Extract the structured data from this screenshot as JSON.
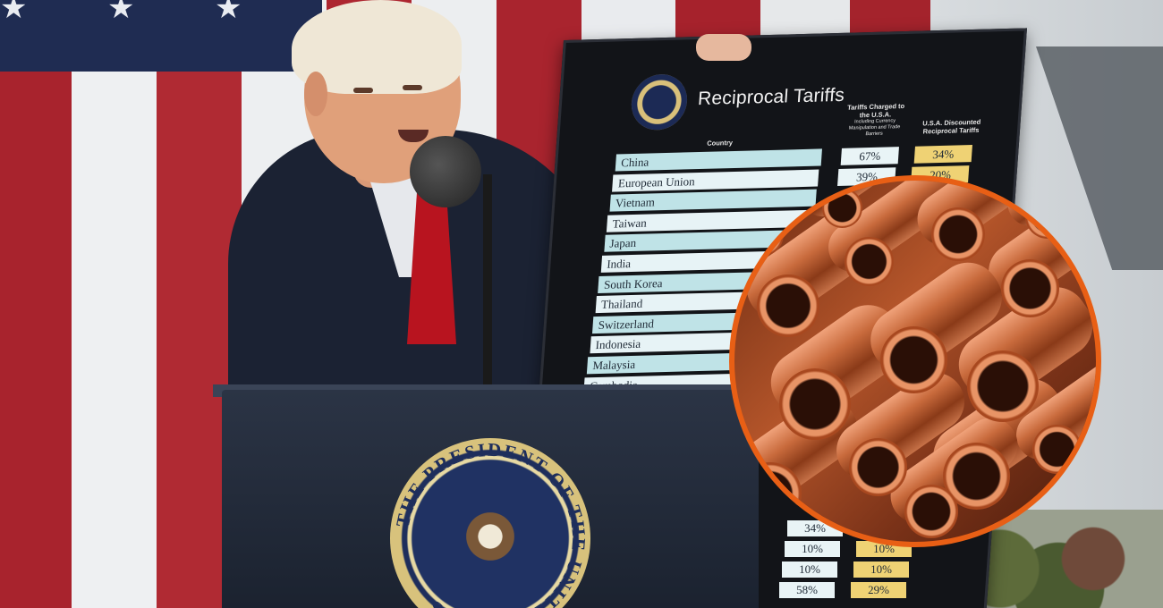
{
  "board": {
    "title": "Reciprocal Tariffs",
    "col_country": "Country",
    "col_charged": "Tariffs Charged to the U.S.A.",
    "col_charged_sub": "Including Currency Manipulation and Trade Barriers",
    "col_discounted": "U.S.A. Discounted Reciprocal Tariffs",
    "rows": [
      {
        "country": "China",
        "charged": "67%",
        "discounted": "34%"
      },
      {
        "country": "European Union",
        "charged": "39%",
        "discounted": "20%"
      },
      {
        "country": "Vietnam"
      },
      {
        "country": "Taiwan"
      },
      {
        "country": "Japan"
      },
      {
        "country": "India"
      },
      {
        "country": "South Korea"
      },
      {
        "country": "Thailand"
      },
      {
        "country": "Switzerland"
      },
      {
        "country": "Indonesia"
      },
      {
        "country": "Malaysia"
      },
      {
        "country": "Cambodia"
      }
    ],
    "lower_rows": [
      {
        "charged": "34%",
        "discounted": ""
      },
      {
        "charged": "10%",
        "discounted": "10%"
      },
      {
        "charged": "10%",
        "discounted": "10%"
      },
      {
        "charged": "58%",
        "discounted": "29%"
      }
    ]
  },
  "seal": {
    "text": "THE PRESIDENT OF THE UNITED STATES"
  },
  "colors": {
    "board_bg": "#121418",
    "country_light": "#e7f3f6",
    "country_teal": "#bfe3e7",
    "discount_yellow": "#efd274",
    "charged_cell": "#e9f4f6",
    "inset_ring": "#e85f15"
  },
  "icons": [
    "presidential-seal-icon",
    "flag-star-icon"
  ]
}
